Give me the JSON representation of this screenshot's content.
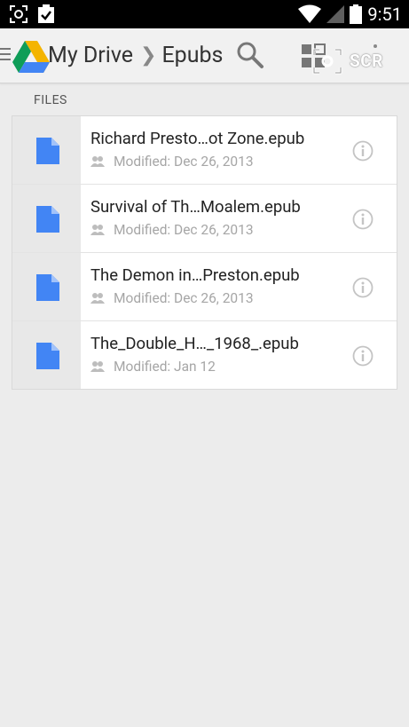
{
  "status_bar": {
    "time": "9:51",
    "left_icons": [
      "screenshot-icon",
      "clipboard-check-icon"
    ],
    "right_icons": [
      "wifi-icon",
      "signal-icon",
      "battery-icon"
    ]
  },
  "action_bar": {
    "crumb_root": "My Drive",
    "crumb_separator": "❯",
    "crumb_current": "Epubs",
    "overlay_label": "SCR"
  },
  "section": {
    "label": "FILES"
  },
  "files": [
    {
      "name": "Richard Presto…ot Zone.epub",
      "modified": "Modified: Dec 26, 2013"
    },
    {
      "name": "Survival of Th…Moalem.epub",
      "modified": "Modified: Dec 26, 2013"
    },
    {
      "name": "The Demon in…Preston.epub",
      "modified": "Modified: Dec 26, 2013"
    },
    {
      "name": "The_Double_H…_1968_.epub",
      "modified": "Modified: Jan 12"
    }
  ],
  "colors": {
    "doc_blue": "#4285f4",
    "drive_green": "#0f9d58",
    "drive_yellow": "#f4b400",
    "drive_blue": "#4285f4"
  }
}
